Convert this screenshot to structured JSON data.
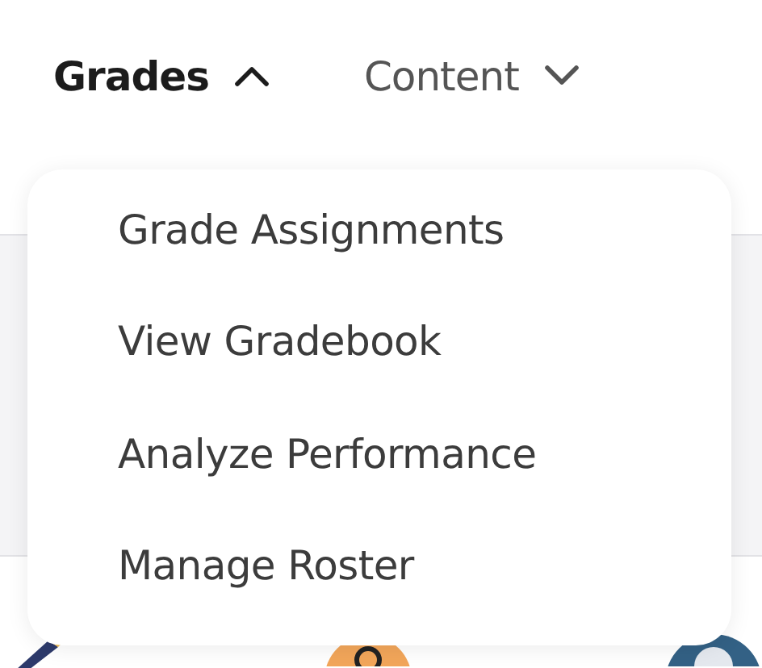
{
  "nav": [
    {
      "label": "Grades",
      "expanded": true
    },
    {
      "label": "Content",
      "expanded": false
    }
  ],
  "menu": {
    "items": [
      "Grade Assignments",
      "View Gradebook",
      "Analyze Performance",
      "Manage Roster"
    ]
  }
}
